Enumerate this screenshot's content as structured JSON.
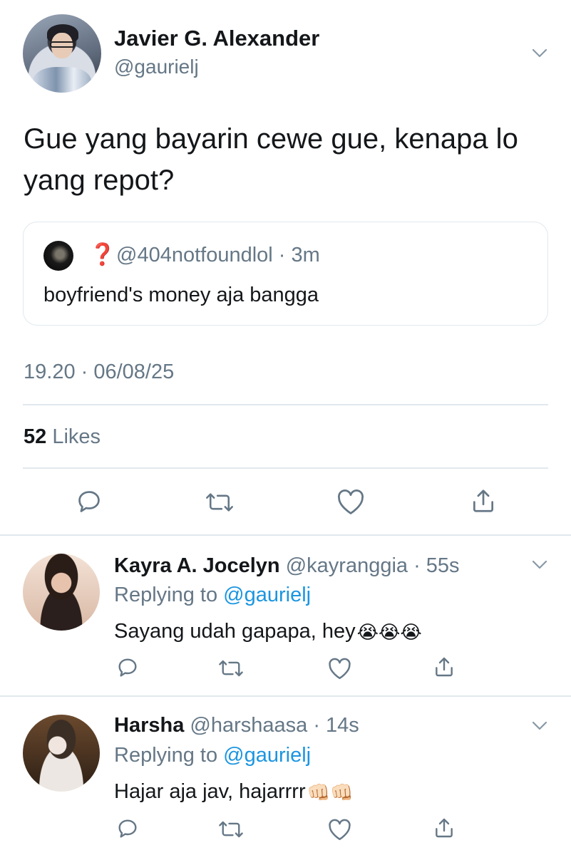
{
  "tweet": {
    "author_name": "Javier G. Alexander",
    "author_handle": "@gaurielj",
    "text": "Gue yang bayarin cewe gue, kenapa lo yang repot?",
    "quote": {
      "emoji": "❓",
      "handle_time": "@404notfoundlol · 3m",
      "text": "boyfriend's money aja bangga"
    },
    "timestamp": "19.20 · 06/08/25",
    "likes_count": "52",
    "likes_label": "Likes"
  },
  "replies": [
    {
      "name": "Kayra A. Jocelyn",
      "handle_time": "@kayranggia · 55s",
      "replying_prefix": "Replying to",
      "replying_user": "@gaurielj",
      "text": "Sayang udah gapapa, hey",
      "emojis": "😭😭😭"
    },
    {
      "name": "Harsha",
      "handle_time": "@harshaasa · 14s",
      "replying_prefix": "Replying to",
      "replying_user": "@gaurielj",
      "text": "Hajar aja jav, hajarrrr",
      "emojis": "👊🏻👊🏻"
    }
  ],
  "icons": {
    "reply": "reply-icon",
    "retweet": "retweet-icon",
    "like": "heart-icon",
    "share": "share-icon",
    "menu": "chevron-down-icon"
  },
  "colors": {
    "text": "#14171a",
    "secondary": "#657786",
    "link": "#1b95e0",
    "divider": "#e1e8ed"
  }
}
